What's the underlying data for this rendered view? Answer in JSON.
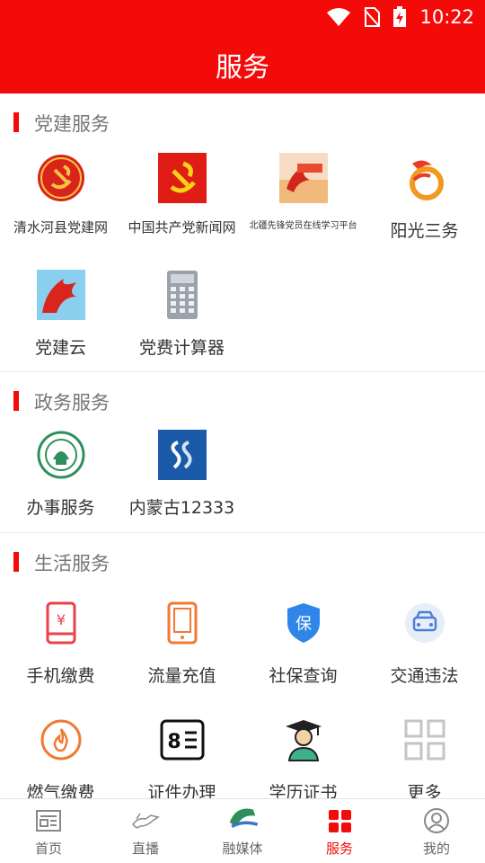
{
  "status": {
    "time": "10:22"
  },
  "header": {
    "title": "服务"
  },
  "sections": [
    {
      "title": "党建服务",
      "items": [
        {
          "label": "清水河县党建网",
          "icon": "party-emblem-icon"
        },
        {
          "label": "中国共产党新闻网",
          "icon": "party-flag-icon"
        },
        {
          "label": "北疆先锋党员在线学习平台",
          "icon": "horse-banner-icon"
        },
        {
          "label": "阳光三务",
          "icon": "sun-logo-icon"
        },
        {
          "label": "党建云",
          "icon": "red-horse-icon"
        },
        {
          "label": "党费计算器",
          "icon": "calculator-icon"
        }
      ]
    },
    {
      "title": "政务服务",
      "items": [
        {
          "label": "办事服务",
          "icon": "seal-icon"
        },
        {
          "label": "内蒙古12333",
          "icon": "blue-s-logo-icon"
        }
      ]
    },
    {
      "title": "生活服务",
      "items": [
        {
          "label": "手机缴费",
          "icon": "phone-pay-icon"
        },
        {
          "label": "流量充值",
          "icon": "data-topup-icon"
        },
        {
          "label": "社保查询",
          "icon": "shield-icon"
        },
        {
          "label": "交通违法",
          "icon": "car-icon"
        },
        {
          "label": "燃气缴费",
          "icon": "flame-icon"
        },
        {
          "label": "证件办理",
          "icon": "id-card-icon"
        },
        {
          "label": "学历证书",
          "icon": "graduate-icon"
        },
        {
          "label": "更多",
          "icon": "grid-icon"
        }
      ]
    }
  ],
  "tabs": [
    {
      "label": "首页",
      "icon": "news-icon"
    },
    {
      "label": "直播",
      "icon": "horse-icon"
    },
    {
      "label": "融媒体",
      "icon": "wall-logo-icon"
    },
    {
      "label": "服务",
      "icon": "apps-icon",
      "active": true
    },
    {
      "label": "我的",
      "icon": "profile-icon"
    }
  ],
  "colors": {
    "accent": "#f50a0a",
    "text": "#333333",
    "muted": "#777777"
  }
}
